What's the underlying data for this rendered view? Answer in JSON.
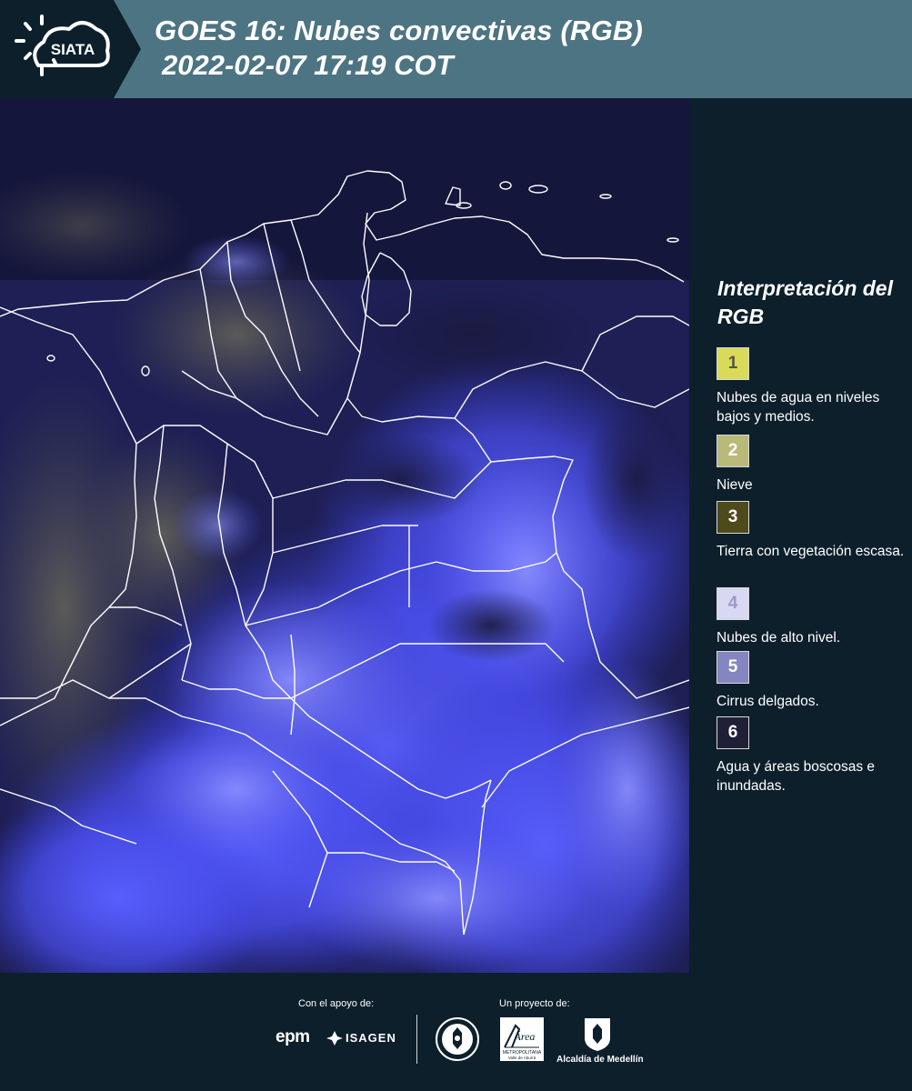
{
  "header": {
    "logo_text": "SIATA",
    "title_line1": "GOES 16: Nubes convectivas (RGB)",
    "title_line2": "2022-02-07 17:19 COT"
  },
  "legend": {
    "title": "Interpretación del RGB",
    "items": [
      {
        "number": "1",
        "label": "Nubes de agua en niveles bajos y medios.",
        "color": "#d9d95a",
        "text_color": "#555540"
      },
      {
        "number": "2",
        "label": "Nieve",
        "color": "#b9b97a",
        "text_color": "#ffffff"
      },
      {
        "number": "3",
        "label": "Tierra con vegetación escasa.",
        "color": "#4d4a1c",
        "text_color": "#ffffff"
      },
      {
        "number": "4",
        "label": "Nubes de alto nivel.",
        "color": "#d8d8f2",
        "text_color": "#9a9ac8"
      },
      {
        "number": "5",
        "label": "Cirrus delgados.",
        "color": "#8585c2",
        "text_color": "#ffffff"
      },
      {
        "number": "6",
        "label": "Agua y áreas boscosas e inundadas.",
        "color": "#1f2036",
        "text_color": "#ffffff"
      }
    ]
  },
  "footer": {
    "support_label": "Con el apoyo de:",
    "project_label": "Un proyecto de:",
    "epm": "epm",
    "isagen": "ISAGEN",
    "area_name": "Área",
    "area_sub1": "METROPOLITANA",
    "area_sub2": "Valle de Aburrá",
    "alcaldia": "Alcaldía de Medellín"
  },
  "colors": {
    "header_bg": "#4d7482",
    "panel_bg": "#0c1f2b",
    "map_blue": "#3a3fdc"
  }
}
